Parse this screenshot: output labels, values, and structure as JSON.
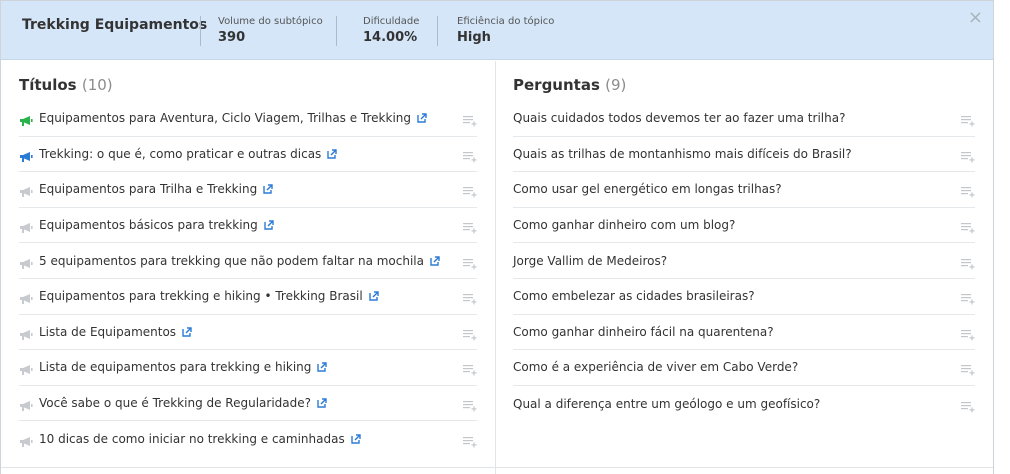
{
  "header": {
    "title": "Trekking Equipamentos",
    "stats": [
      {
        "label": "Volume do subtópico",
        "value": "390"
      },
      {
        "label": "Dificuldade",
        "value": "14.00%"
      },
      {
        "label": "Eficiência do tópico",
        "value": "High"
      }
    ],
    "close_glyph": "×"
  },
  "titles": {
    "heading": "Títulos",
    "count": "(10)",
    "items": [
      {
        "text": "Equipamentos para Aventura, Ciclo Viagem, Trilhas e Trekking",
        "icon": "megaphone-icon",
        "color": "#2bb34a"
      },
      {
        "text": "Trekking: o que é, como praticar e outras dicas",
        "icon": "megaphone-icon",
        "color": "#2a7bd5"
      },
      {
        "text": "Equipamentos para Trilha e Trekking",
        "icon": "megaphone-icon",
        "color": "#c7cbcf"
      },
      {
        "text": "Equipamentos básicos para trekking",
        "icon": "megaphone-icon",
        "color": "#c7cbcf"
      },
      {
        "text": "5 equipamentos para trekking que não podem faltar na mochila",
        "icon": "megaphone-icon",
        "color": "#c7cbcf"
      },
      {
        "text": "Equipamentos para trekking e hiking • Trekking Brasil",
        "icon": "megaphone-icon",
        "color": "#c7cbcf"
      },
      {
        "text": "Lista de Equipamentos",
        "icon": "megaphone-icon",
        "color": "#c7cbcf"
      },
      {
        "text": "Lista de equipamentos para trekking e hiking",
        "icon": "megaphone-icon",
        "color": "#c7cbcf"
      },
      {
        "text": "Você sabe o que é Trekking de Regularidade?",
        "icon": "megaphone-icon",
        "color": "#c7cbcf"
      },
      {
        "text": "10 dicas de como iniciar no trekking e caminhadas",
        "icon": "megaphone-icon",
        "color": "#c7cbcf"
      }
    ]
  },
  "questions": {
    "heading": "Perguntas",
    "count": "(9)",
    "items": [
      {
        "text": "Quais cuidados todos devemos ter ao fazer uma trilha?"
      },
      {
        "text": "Quais as trilhas de montanhismo mais difíceis do Brasil?"
      },
      {
        "text": "Como usar gel energético em longas trilhas?"
      },
      {
        "text": "Como ganhar dinheiro com um blog?"
      },
      {
        "text": "Jorge Vallim de Medeiros?"
      },
      {
        "text": "Como embelezar as cidades brasileiras?"
      },
      {
        "text": "Como ganhar dinheiro fácil na quarentena?"
      },
      {
        "text": "Como é a experiência de viver em Cabo Verde?"
      },
      {
        "text": "Qual a diferença entre um geólogo e um geofísico?"
      }
    ]
  },
  "colors": {
    "header_bg": "#d4e6f8",
    "link_icon": "#2a7bd5",
    "add_icon": "#c3c7cb"
  }
}
